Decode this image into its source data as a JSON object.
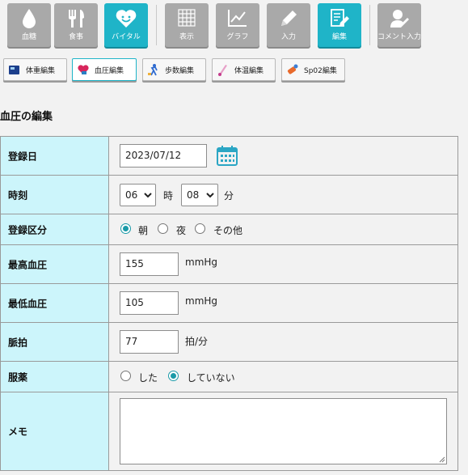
{
  "nav": {
    "items": [
      {
        "label": "血糖",
        "icon": "drop-icon"
      },
      {
        "label": "食事",
        "icon": "fork-knife-icon"
      },
      {
        "label": "バイタル",
        "icon": "heart-face-icon",
        "active": true
      },
      {
        "label": "表示",
        "icon": "grid-icon"
      },
      {
        "label": "グラフ",
        "icon": "chart-icon"
      },
      {
        "label": "入力",
        "icon": "pencil-icon"
      },
      {
        "label": "編集",
        "icon": "edit-doc-icon",
        "active": true
      },
      {
        "label": "コメント入力",
        "icon": "comment-user-icon"
      }
    ]
  },
  "tools": {
    "items": [
      {
        "label": "体重編集",
        "icon": "scale-icon"
      },
      {
        "label": "血圧編集",
        "icon": "heart-icon",
        "active": true
      },
      {
        "label": "歩数編集",
        "icon": "walk-icon"
      },
      {
        "label": "体温編集",
        "icon": "thermometer-icon"
      },
      {
        "label": "Sp02編集",
        "icon": "pulse-oximeter-icon"
      }
    ]
  },
  "page": {
    "title": "血圧の編集"
  },
  "form": {
    "date": {
      "label": "登録日",
      "value": "2023/07/12"
    },
    "time": {
      "label": "時刻",
      "hour": "06",
      "hour_unit": "時",
      "minute": "08",
      "minute_unit": "分"
    },
    "category": {
      "label": "登録区分",
      "options": [
        "朝",
        "夜",
        "その他"
      ],
      "selected": "朝"
    },
    "systolic": {
      "label": "最高血圧",
      "value": "155",
      "unit": "mmHg"
    },
    "diastolic": {
      "label": "最低血圧",
      "value": "105",
      "unit": "mmHg"
    },
    "pulse": {
      "label": "脈拍",
      "value": "77",
      "unit": "拍/分"
    },
    "medication": {
      "label": "服薬",
      "options": [
        "した",
        "していない"
      ],
      "selected": "していない"
    },
    "memo": {
      "label": "メモ",
      "value": ""
    }
  },
  "colors": {
    "accent": "#1fb4c8",
    "header_cell": "#ccf5fb",
    "nav_inactive": "#a9a9a9",
    "calendar": "#2ba6c4"
  }
}
